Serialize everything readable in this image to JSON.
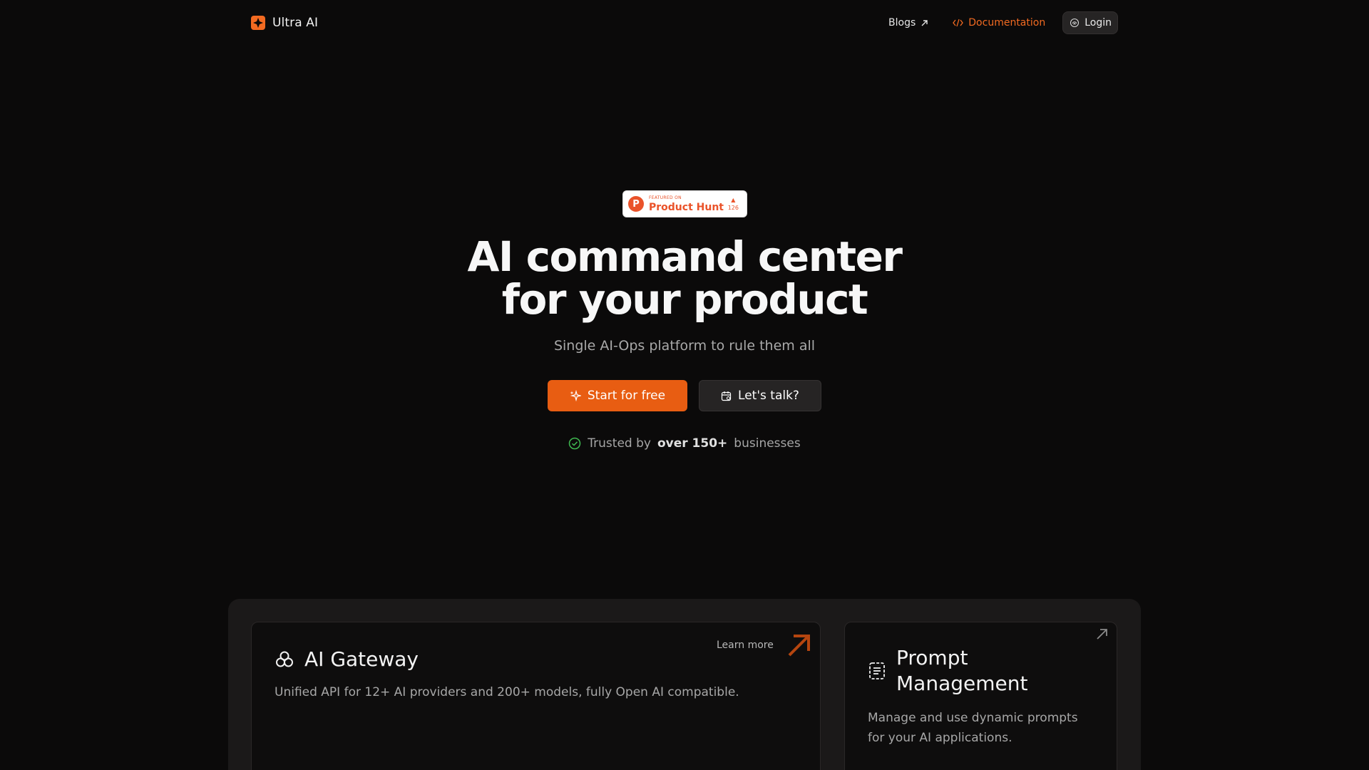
{
  "nav": {
    "brand_name": "Ultra AI",
    "blogs_label": "Blogs",
    "docs_label": "Documentation",
    "login_label": "Login"
  },
  "hero": {
    "badge": {
      "featured_on": "FEATURED ON",
      "name": "Product Hunt",
      "logo_letter": "P",
      "votes": "126"
    },
    "title_line1": "AI command center",
    "title_line2": "for your product",
    "subtitle": "Single AI-Ops platform to rule them all",
    "primary_cta": "Start for free",
    "secondary_cta": "Let's talk?",
    "trusted_prefix": "Trusted by",
    "trusted_bold": "over 150+",
    "trusted_suffix": "businesses"
  },
  "features": [
    {
      "title": "AI Gateway",
      "description": "Unified API for 12+ AI providers and 200+ models, fully Open AI compatible.",
      "link_label": "Learn more"
    },
    {
      "title": "Prompt Management",
      "description": "Manage and use dynamic prompts for your AI applications."
    }
  ],
  "colors": {
    "accent": "#e85d12",
    "accent_text": "#f26a21",
    "background": "#0b0a0a",
    "success": "#3fb950"
  }
}
